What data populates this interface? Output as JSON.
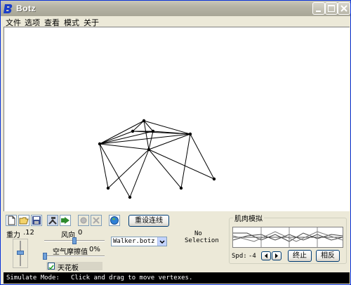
{
  "window": {
    "title": "Botz"
  },
  "menu": {
    "items": [
      "文件",
      "选项",
      "查看",
      "模式",
      "关于"
    ]
  },
  "toolbar": {
    "reset_links_label": "重设连线",
    "file_select_value": "Walker.botz",
    "selection_line1": "No",
    "selection_line2": "Selection"
  },
  "physics": {
    "gravity_label": "重力",
    "gravity_value": ".12",
    "wind_label": "风向",
    "wind_value": "0",
    "air_friction_label": "空气摩擦值",
    "air_friction_value": "0%",
    "ceiling_label": "天花板",
    "ceiling_checked": true
  },
  "muscle": {
    "group_title": "肌肉模拟",
    "speed_label": "Spd:",
    "speed_value": "-4",
    "stop_label": "终止",
    "reverse_label": "相反"
  },
  "status": {
    "mode": "Simulate Mode:",
    "message": "Click and drag to move vertexes."
  },
  "colors": {
    "titlebar": "#B5B3A5",
    "face": "#ECE9D8",
    "accent": "#0831D9"
  }
}
